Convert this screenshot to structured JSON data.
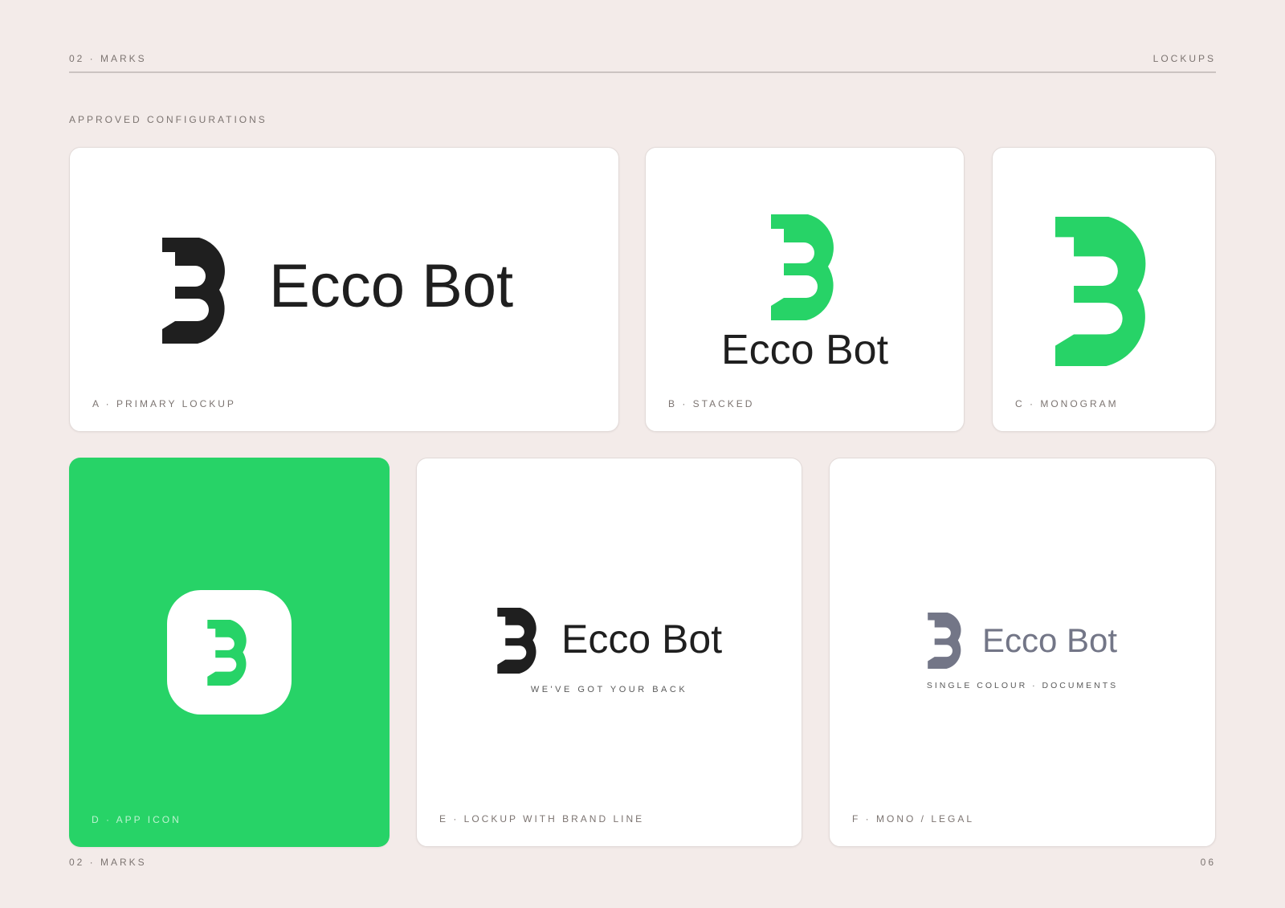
{
  "header": {
    "section": "02 · MARKS",
    "topic": "LOCKUPS"
  },
  "section_title": "APPROVED CONFIGURATIONS",
  "brand": {
    "name": "Ecco Bot",
    "tagline": "WE'VE GOT YOUR BACK",
    "colors": {
      "green": "#27d367",
      "ink": "#1f1f1f",
      "mono": "#737687",
      "page_background": "#f3ebe9",
      "card_background": "#ffffff"
    },
    "mark_icon": "b-speech-bubble-logo-icon"
  },
  "cards": {
    "a": {
      "label": "A · PRIMARY LOCKUP",
      "wordmark": "Ecco Bot",
      "mark_color": "#1f1f1f"
    },
    "b": {
      "label": "B · STACKED",
      "wordmark": "Ecco Bot",
      "mark_color": "#27d367"
    },
    "c": {
      "label": "C · MONOGRAM",
      "mark_color": "#27d367"
    },
    "d": {
      "label": "D · APP ICON",
      "mark_color": "#27d367",
      "tile_color": "#ffffff"
    },
    "e": {
      "label": "E · LOCKUP WITH BRAND LINE",
      "wordmark": "Ecco Bot",
      "tagline": "WE'VE GOT YOUR BACK",
      "mark_color": "#1f1f1f"
    },
    "f": {
      "label": "F · MONO / LEGAL",
      "wordmark": "Ecco Bot",
      "tagline": "SINGLE COLOUR · DOCUMENTS",
      "mark_color": "#737687"
    }
  },
  "footer": {
    "section": "02 · MARKS",
    "page_number": "06"
  }
}
